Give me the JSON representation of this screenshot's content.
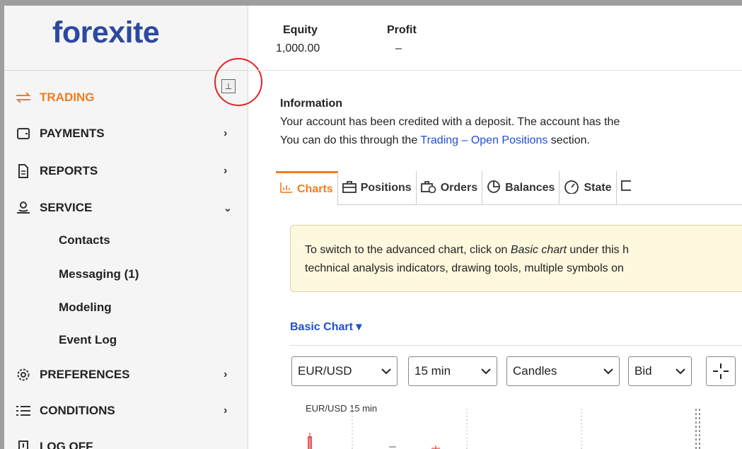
{
  "sidebar": {
    "logo": "forexite",
    "pin_icon": "pin-icon",
    "items": [
      {
        "label": "TRADING",
        "icon": "swap-arrows-icon",
        "active": true
      },
      {
        "label": "PAYMENTS",
        "icon": "wallet-icon"
      },
      {
        "label": "REPORTS",
        "icon": "document-icon"
      },
      {
        "label": "SERVICE",
        "icon": "service-icon"
      },
      {
        "label": "PREFERENCES",
        "icon": "gear-icon"
      },
      {
        "label": "CONDITIONS",
        "icon": "list-icon"
      },
      {
        "label": "LOG OFF",
        "icon": "logoff-icon"
      }
    ],
    "service_sub": [
      "Contacts",
      "Messaging (1)",
      "Modeling",
      "Event Log"
    ]
  },
  "header": {
    "equity_label": "Equity",
    "equity_value": "1,000.00",
    "profit_label": "Profit",
    "profit_value": "–"
  },
  "info": {
    "title": "Information",
    "line1": "Your account has been credited with a deposit. The account has the",
    "line2_pre": "You can do this through the ",
    "line2_link": "Trading – Open Positions",
    "line2_post": " section."
  },
  "tabs": [
    {
      "label": "Charts",
      "icon": "bar-chart-icon",
      "active": true
    },
    {
      "label": "Positions",
      "icon": "briefcase-icon"
    },
    {
      "label": "Orders",
      "icon": "briefcase-clock-icon"
    },
    {
      "label": "Balances",
      "icon": "pie-chart-icon"
    },
    {
      "label": "State",
      "icon": "gauge-icon"
    }
  ],
  "notice": {
    "line1_pre": "To switch to the advanced chart, click on ",
    "line1_em": "Basic chart",
    "line1_post": " under this h",
    "line2": "technical analysis indicators, drawing tools, multiple symbols on"
  },
  "chart": {
    "mode_label": "Basic Chart ▾",
    "symbol": "EUR/USD",
    "interval": "15 min",
    "type": "Candles",
    "price": "Bid",
    "chart_title": "EUR/USD 15 min"
  },
  "colors": {
    "accent": "#f07c22",
    "link": "#1f4fcf",
    "logo": "#2b4a9e"
  }
}
